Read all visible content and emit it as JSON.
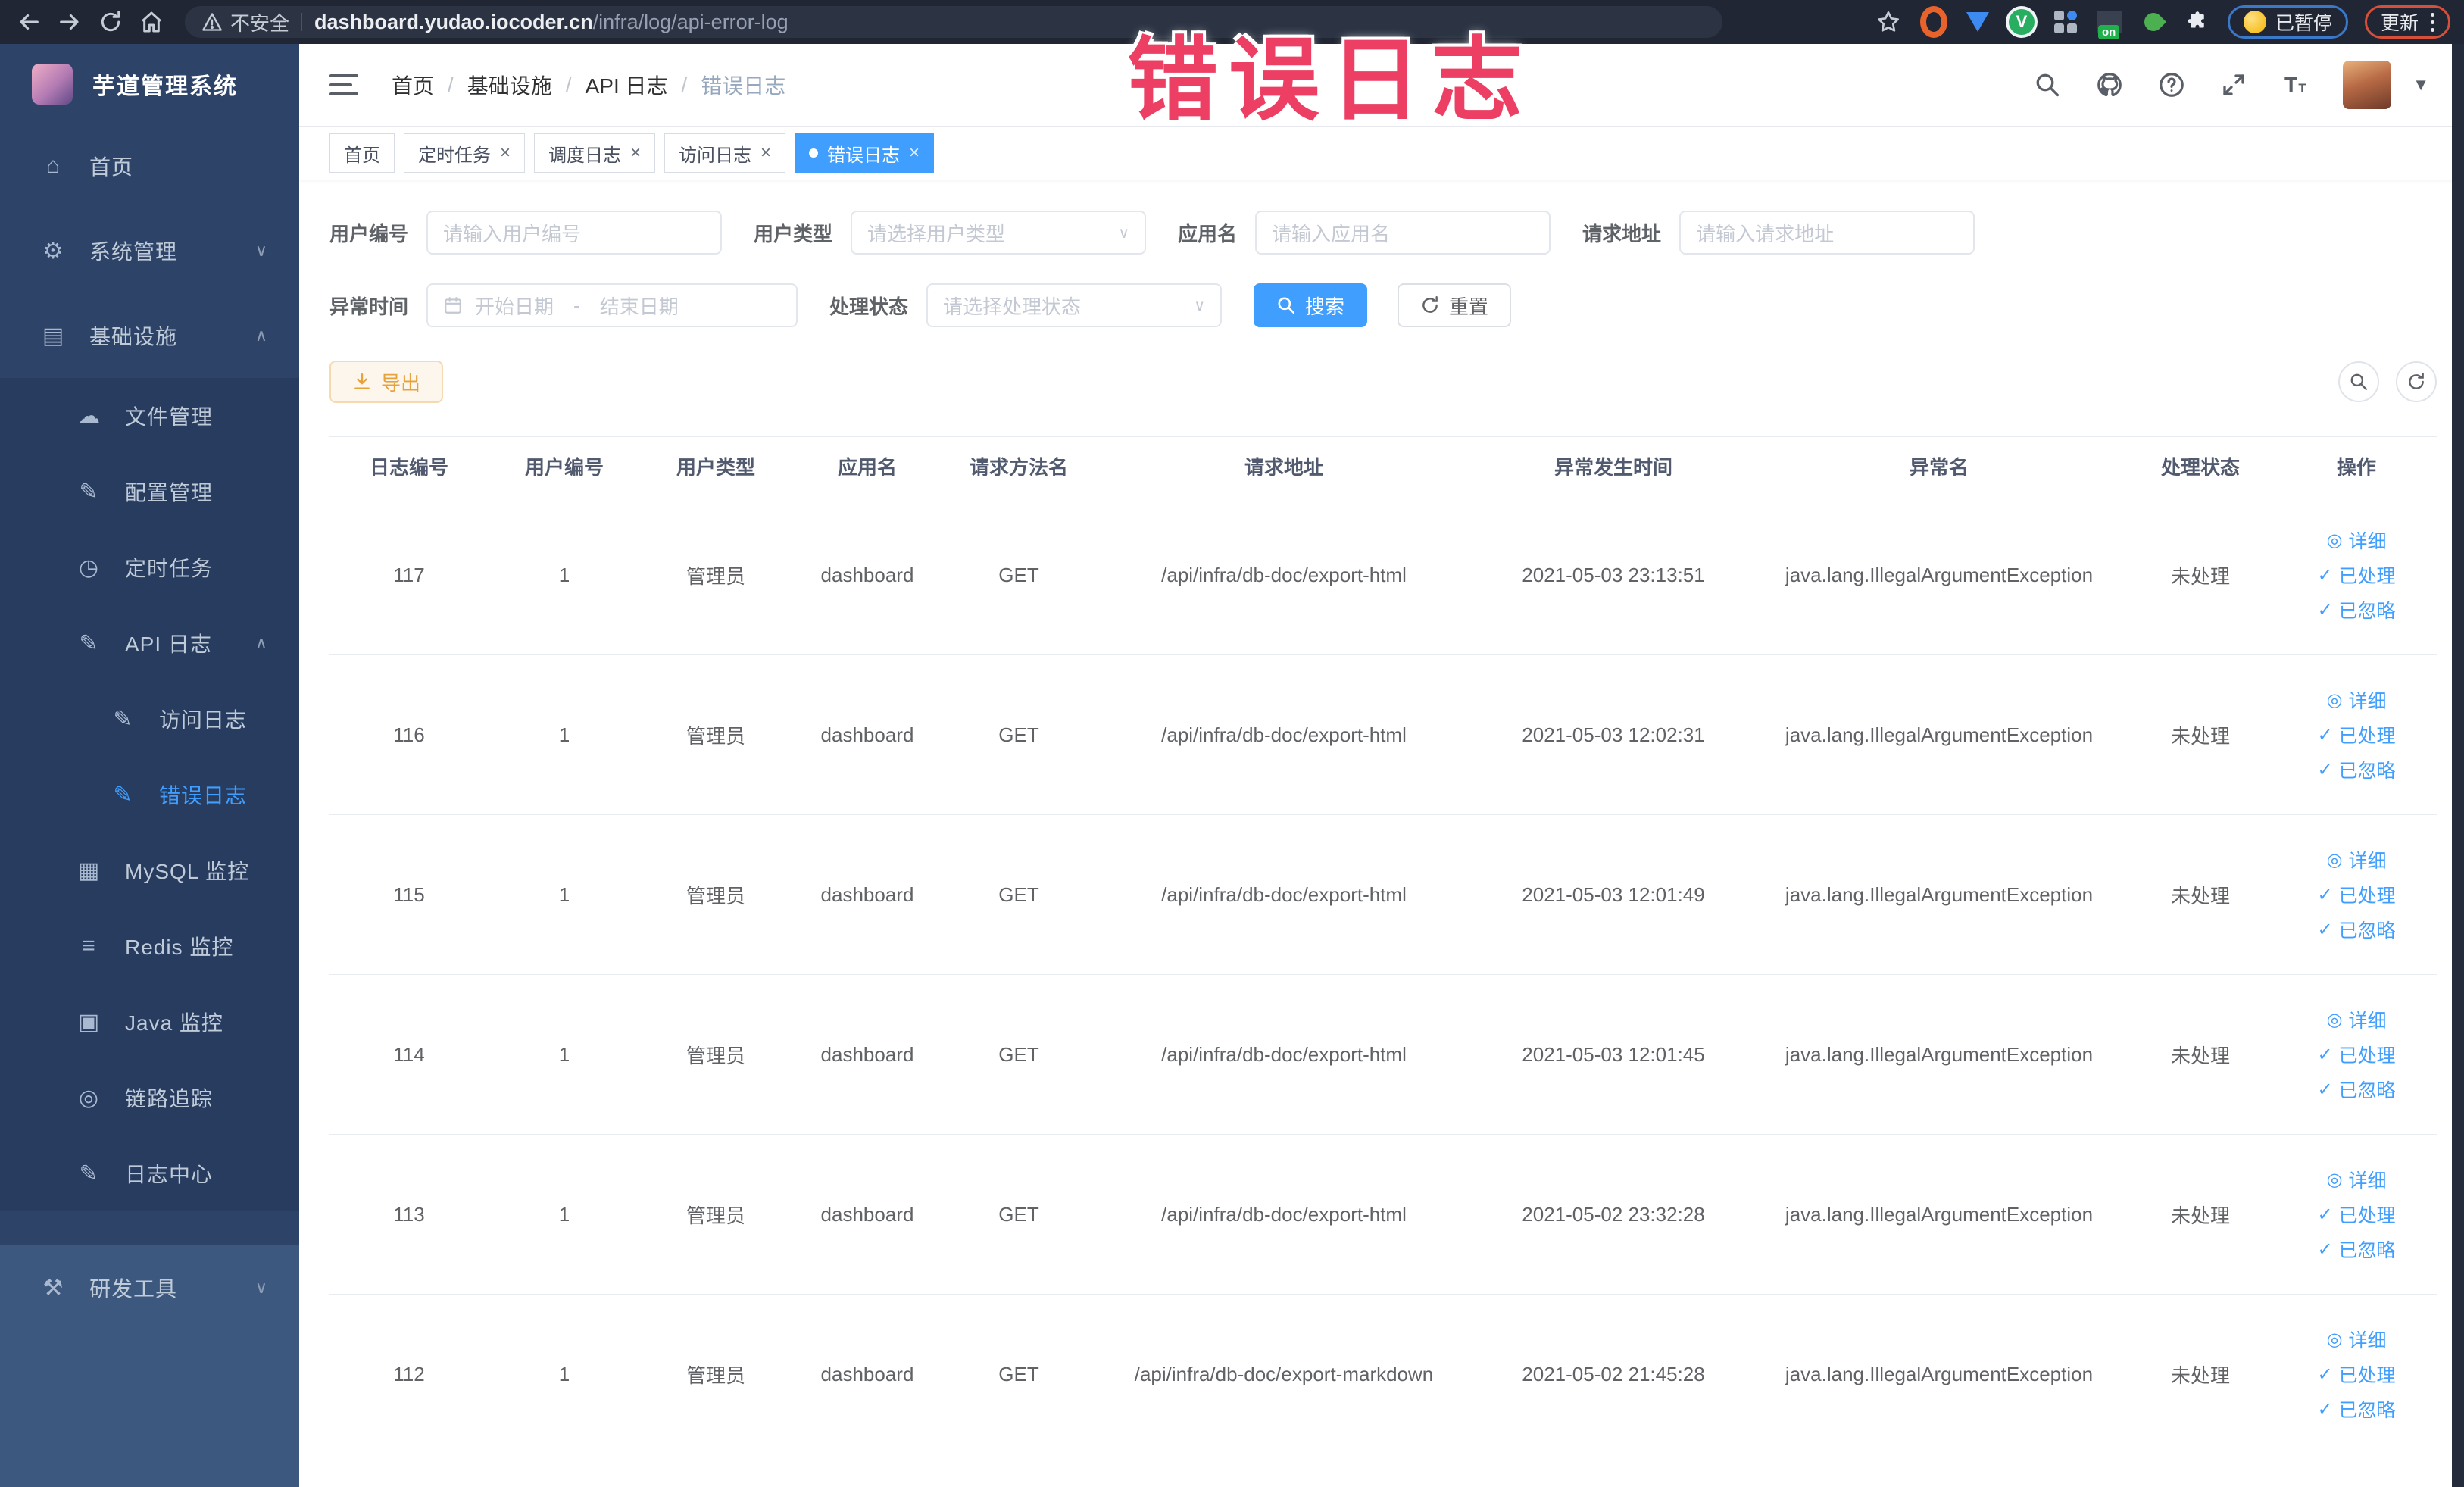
{
  "browser": {
    "security_label": "不安全",
    "url_host": "dashboard.yudao.iocoder.cn",
    "url_path": "/infra/log/api-error-log",
    "paused_badge": "已暂停",
    "update_label": "更新",
    "extension_on_badge": "on",
    "extensions": [
      "bookmark-star-icon",
      "orange-ring-extension-icon",
      "blue-drop-extension-icon",
      "green-v-extension-icon",
      "grid-extension-icon",
      "on-badge-extension-icon",
      "plant-extension-icon",
      "puzzle-extensions-icon"
    ]
  },
  "overlay_title": "错误日志",
  "sidebar": {
    "title": "芋道管理系统",
    "menu": [
      {
        "key": "home",
        "label": "首页",
        "icon": "home-icon",
        "level": 0
      },
      {
        "key": "system",
        "label": "系统管理",
        "icon": "gear-icon",
        "level": 0,
        "chevron": "down"
      },
      {
        "key": "infra",
        "label": "基础设施",
        "icon": "infra-icon",
        "level": 0,
        "chevron": "up"
      },
      {
        "key": "file",
        "label": "文件管理",
        "icon": "cloud-upload-icon",
        "level": 1
      },
      {
        "key": "config",
        "label": "配置管理",
        "icon": "edit-icon",
        "level": 1
      },
      {
        "key": "job",
        "label": "定时任务",
        "icon": "clock-icon",
        "level": 1
      },
      {
        "key": "api-log",
        "label": "API 日志",
        "icon": "log-icon",
        "level": 1,
        "chevron": "up"
      },
      {
        "key": "access-log",
        "label": "访问日志",
        "icon": "log-icon",
        "level": 2
      },
      {
        "key": "error-log",
        "label": "错误日志",
        "icon": "log-icon",
        "level": 2,
        "active": true
      },
      {
        "key": "mysql",
        "label": "MySQL 监控",
        "icon": "mysql-icon",
        "level": 1
      },
      {
        "key": "redis",
        "label": "Redis 监控",
        "icon": "redis-icon",
        "level": 1
      },
      {
        "key": "java",
        "label": "Java 监控",
        "icon": "java-icon",
        "level": 1
      },
      {
        "key": "trace",
        "label": "链路追踪",
        "icon": "trace-eye-icon",
        "level": 1
      },
      {
        "key": "log-center",
        "label": "日志中心",
        "icon": "log-icon",
        "level": 1
      },
      {
        "key": "dev-tool",
        "label": "研发工具",
        "icon": "toolbox-icon",
        "level": 0,
        "chevron": "down",
        "section": "light"
      }
    ]
  },
  "breadcrumb": {
    "items": [
      "首页",
      "基础设施",
      "API 日志",
      "错误日志"
    ]
  },
  "tabs": [
    {
      "label": "首页",
      "closable": false,
      "active": false
    },
    {
      "label": "定时任务",
      "closable": true,
      "active": false
    },
    {
      "label": "调度日志",
      "closable": true,
      "active": false
    },
    {
      "label": "访问日志",
      "closable": true,
      "active": false
    },
    {
      "label": "错误日志",
      "closable": true,
      "active": true
    }
  ],
  "filters": {
    "user_id": {
      "label": "用户编号",
      "placeholder": "请输入用户编号"
    },
    "user_type": {
      "label": "用户类型",
      "placeholder": "请选择用户类型"
    },
    "app_name": {
      "label": "应用名",
      "placeholder": "请输入应用名"
    },
    "request_url": {
      "label": "请求地址",
      "placeholder": "请输入请求地址"
    },
    "exception_time": {
      "label": "异常时间",
      "start_placeholder": "开始日期",
      "separator": "-",
      "end_placeholder": "结束日期"
    },
    "process_status": {
      "label": "处理状态",
      "placeholder": "请选择处理状态"
    },
    "search_label": "搜索",
    "reset_label": "重置"
  },
  "toolbar": {
    "export_label": "导出"
  },
  "table": {
    "columns": [
      "日志编号",
      "用户编号",
      "用户类型",
      "应用名",
      "请求方法名",
      "请求地址",
      "异常发生时间",
      "异常名",
      "处理状态",
      "操作"
    ],
    "action_labels": {
      "detail": "详细",
      "processed": "已处理",
      "ignored": "已忽略"
    },
    "rows": [
      {
        "id": "117",
        "user_id": "1",
        "user_type": "管理员",
        "app": "dashboard",
        "method": "GET",
        "url": "/api/infra/db-doc/export-html",
        "time": "2021-05-03 23:13:51",
        "exception": "java.lang.IllegalArgumentException",
        "status": "未处理"
      },
      {
        "id": "116",
        "user_id": "1",
        "user_type": "管理员",
        "app": "dashboard",
        "method": "GET",
        "url": "/api/infra/db-doc/export-html",
        "time": "2021-05-03 12:02:31",
        "exception": "java.lang.IllegalArgumentException",
        "status": "未处理"
      },
      {
        "id": "115",
        "user_id": "1",
        "user_type": "管理员",
        "app": "dashboard",
        "method": "GET",
        "url": "/api/infra/db-doc/export-html",
        "time": "2021-05-03 12:01:49",
        "exception": "java.lang.IllegalArgumentException",
        "status": "未处理"
      },
      {
        "id": "114",
        "user_id": "1",
        "user_type": "管理员",
        "app": "dashboard",
        "method": "GET",
        "url": "/api/infra/db-doc/export-html",
        "time": "2021-05-03 12:01:45",
        "exception": "java.lang.IllegalArgumentException",
        "status": "未处理"
      },
      {
        "id": "113",
        "user_id": "1",
        "user_type": "管理员",
        "app": "dashboard",
        "method": "GET",
        "url": "/api/infra/db-doc/export-html",
        "time": "2021-05-02 23:32:28",
        "exception": "java.lang.IllegalArgumentException",
        "status": "未处理"
      },
      {
        "id": "112",
        "user_id": "1",
        "user_type": "管理员",
        "app": "dashboard",
        "method": "GET",
        "url": "/api/infra/db-doc/export-markdown",
        "time": "2021-05-02 21:45:28",
        "exception": "java.lang.IllegalArgumentException",
        "status": "未处理"
      }
    ]
  },
  "colors": {
    "accent": "#409eff",
    "warning": "#e6a23c",
    "overlay": "#ec3f63",
    "sidebar": "#2e4368"
  }
}
